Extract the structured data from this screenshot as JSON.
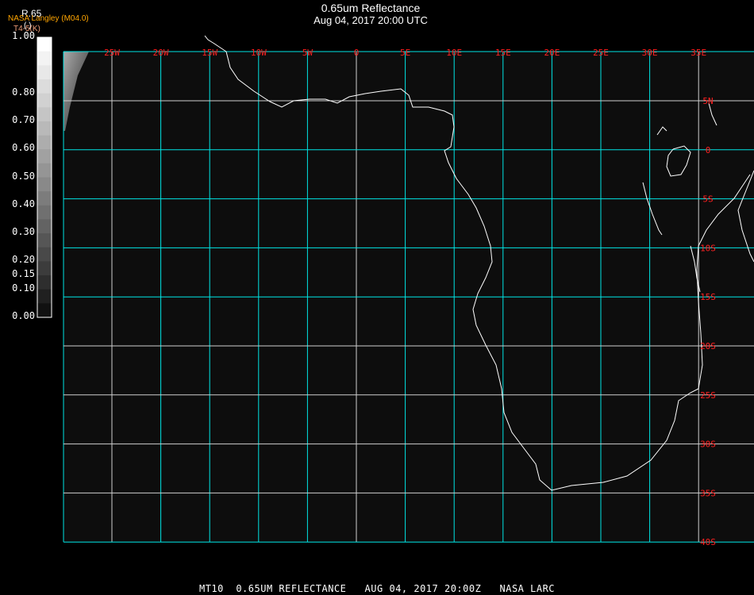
{
  "header": {
    "title": "0.65um Reflectance",
    "subtitle": "Aug 04, 2017 20:00 UTC"
  },
  "legend": {
    "organization": "NASA Langley (M04.0)",
    "band": "R.65",
    "band_paren": "( )",
    "secondary": "T4-5(K)",
    "ticks": [
      "1.00",
      "0.80",
      "0.70",
      "0.60",
      "0.50",
      "0.40",
      "0.30",
      "0.20",
      "0.15",
      "0.10",
      "0.00"
    ],
    "tick_values": [
      1.0,
      0.8,
      0.7,
      0.6,
      0.5,
      0.4,
      0.3,
      0.2,
      0.15,
      0.1,
      0.0
    ],
    "range": [
      0,
      1
    ]
  },
  "map": {
    "longitudes": [
      "25W",
      "20W",
      "15W",
      "10W",
      "5W",
      "0",
      "5E",
      "10E",
      "15E",
      "20E",
      "25E",
      "30E",
      "35E"
    ],
    "latitudes": [
      "5N",
      "0",
      "5S",
      "10S",
      "15S",
      "20S",
      "25S",
      "30S",
      "35S",
      "40S"
    ],
    "grid_color": "#00e5e5",
    "label_color": "#ff2020",
    "coast_color": "#ffffff"
  },
  "footer": {
    "text": "MT10  0.65UM REFLECTANCE   AUG 04, 2017 20:00Z   NASA LARC"
  }
}
